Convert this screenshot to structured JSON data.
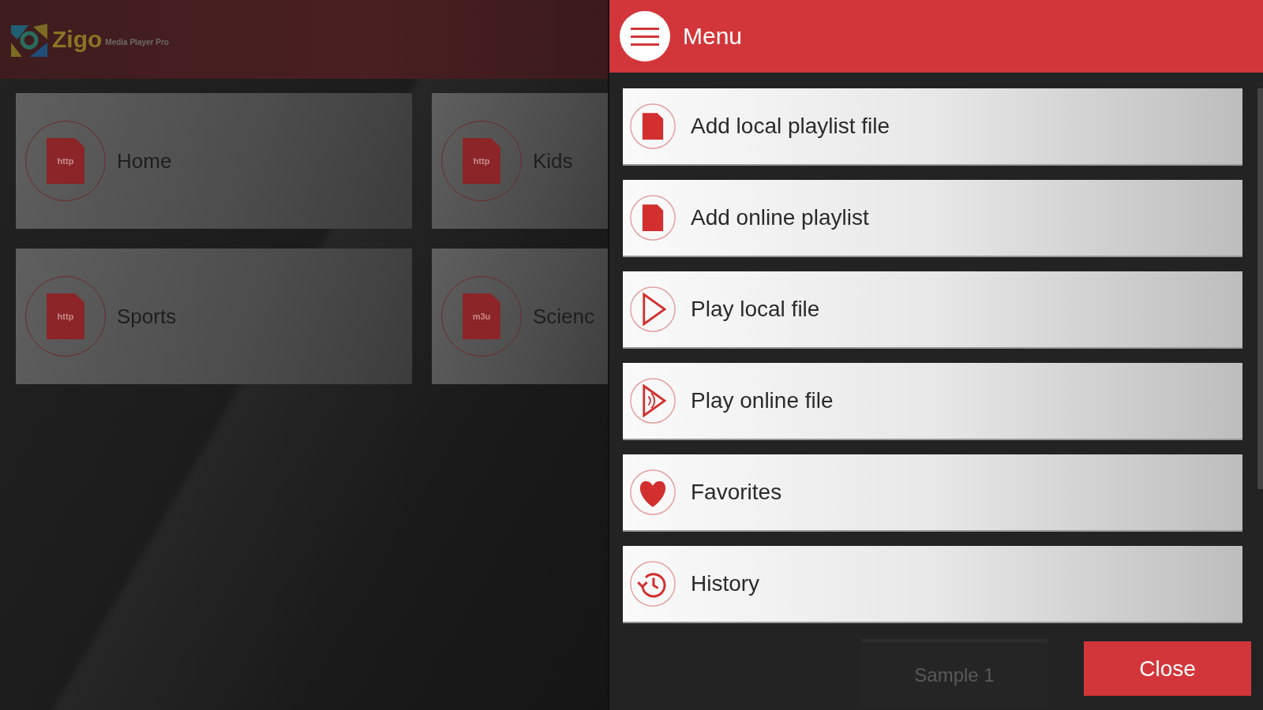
{
  "logo": {
    "name": "Zigo",
    "tagline": "Media Player Pro"
  },
  "playlists": [
    {
      "label": "Home",
      "file_type": "http"
    },
    {
      "label": "Kids",
      "file_type": "http"
    },
    {
      "label": "Sports",
      "file_type": "http"
    },
    {
      "label": "Scienc",
      "file_type": "m3u"
    }
  ],
  "menu": {
    "title": "Menu",
    "items": [
      {
        "label": "Add local playlist file",
        "kind": "file"
      },
      {
        "label": "Add online playlist",
        "kind": "file"
      },
      {
        "label": "Play local file",
        "kind": "play"
      },
      {
        "label": "Play online file",
        "kind": "stream"
      },
      {
        "label": "Favorites",
        "kind": "heart"
      },
      {
        "label": "History",
        "kind": "history"
      }
    ],
    "background_tile": "Sample 1",
    "close_button": "Close"
  }
}
